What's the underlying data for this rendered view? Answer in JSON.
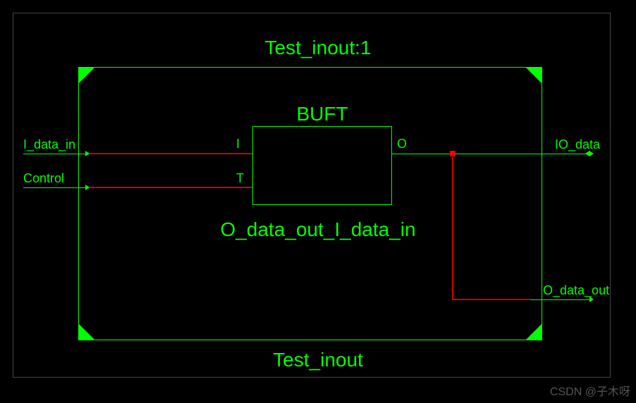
{
  "title_instance": "Test_inout:1",
  "title_component": "Test_inout",
  "buft_label": "BUFT",
  "instance_name": "O_data_out_I_data_in",
  "ports": {
    "i": "I",
    "t": "T",
    "o": "O",
    "i_data_in": "I_data_in",
    "control": "Control",
    "io_data": "IO_data",
    "o_data_out": "O_data_out"
  },
  "watermark": "CSDN @子木呀",
  "colors": {
    "wire_normal": "#00ff00",
    "wire_selected": "#cc0000",
    "background": "#000000"
  },
  "chart_data": {
    "type": "block_diagram",
    "top_module": "Test_inout",
    "instance": "Test_inout:1",
    "cells": [
      {
        "name": "O_data_out_I_data_in",
        "type": "BUFT",
        "ports": [
          "I",
          "T",
          "O"
        ]
      }
    ],
    "external_ports": [
      {
        "name": "I_data_in",
        "direction": "input"
      },
      {
        "name": "Control",
        "direction": "input"
      },
      {
        "name": "IO_data",
        "direction": "inout"
      },
      {
        "name": "O_data_out",
        "direction": "output"
      }
    ],
    "nets": [
      {
        "from": "I_data_in",
        "to": "BUFT.I",
        "highlighted": true
      },
      {
        "from": "Control",
        "to": "BUFT.T",
        "highlighted": true
      },
      {
        "from": "BUFT.O",
        "to": "IO_data",
        "highlighted": false
      },
      {
        "from": "BUFT.O",
        "to": "O_data_out",
        "highlighted": true,
        "tap_from_io_data_net": true
      }
    ]
  }
}
